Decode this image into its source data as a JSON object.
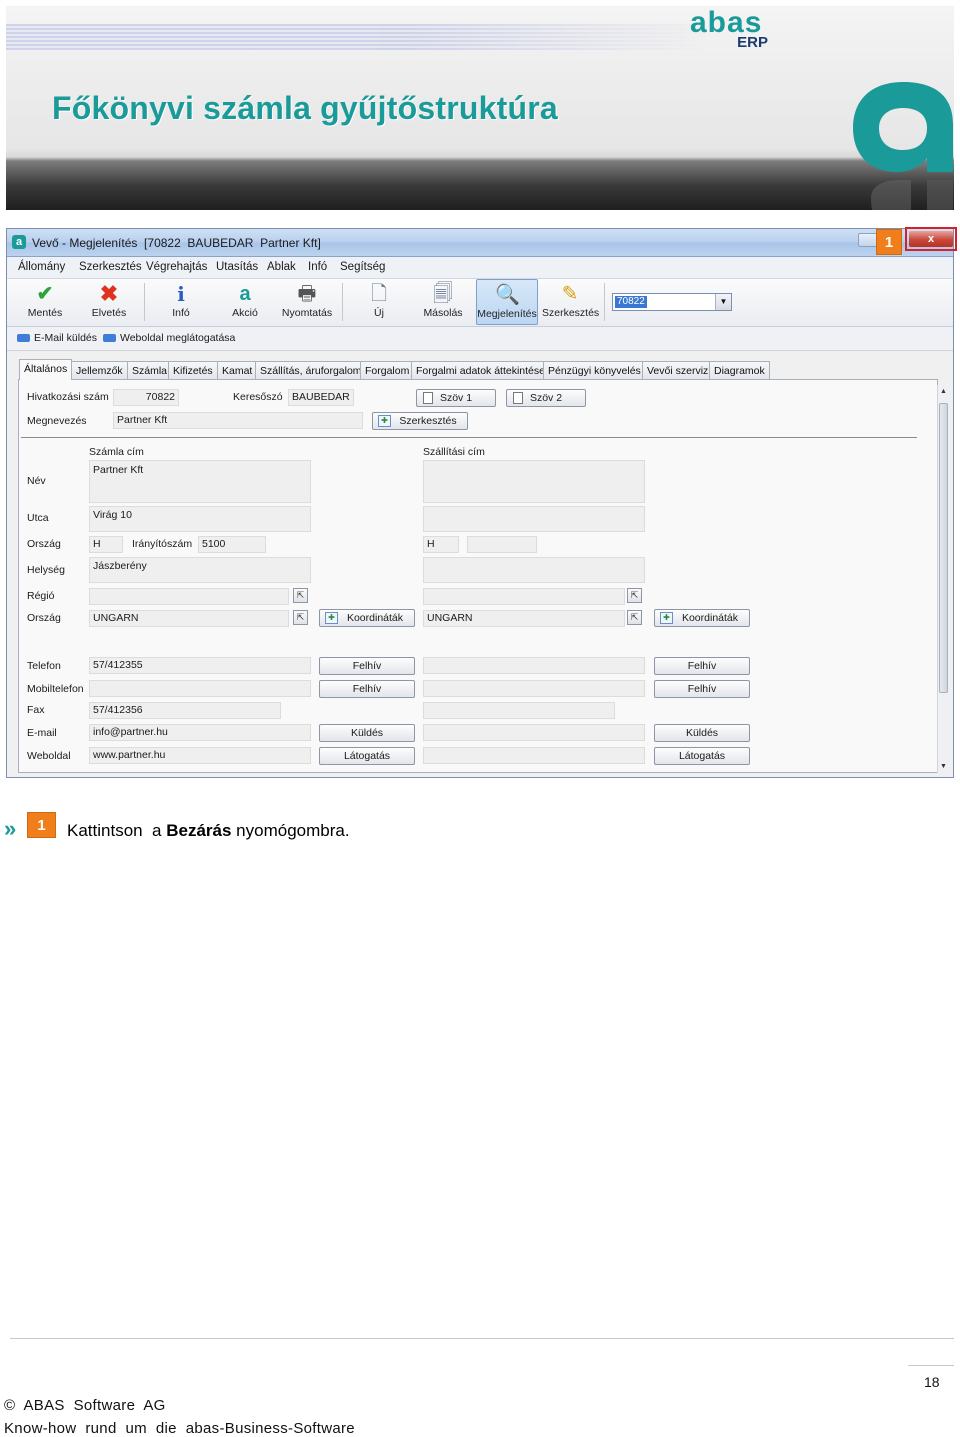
{
  "banner": {
    "title": "Főkönyvi számla gyűjtőstruktúra",
    "logo_word": "abas",
    "logo_sub": "ERP"
  },
  "window": {
    "title": "Vevő - Megjelenítés  [70822  BAUBEDAR  Partner Kft]",
    "callout": "1",
    "close": "x"
  },
  "menu": [
    "Állomány",
    "Szerkesztés",
    "Végrehajtás",
    "Utasítás",
    "Ablak",
    "Infó",
    "Segítség"
  ],
  "toolbar": {
    "buttons": [
      "Mentés",
      "Elvetés",
      "Infó",
      "Akció",
      "Nyomtatás",
      "Új",
      "Másolás",
      "Megjelenítés",
      "Szerkesztés"
    ],
    "combo_value": "70822"
  },
  "links": [
    "E-Mail küldés",
    "Weboldal meglátogatása"
  ],
  "tabs": [
    "Általános",
    "Jellemzők",
    "Számla",
    "Kifizetés",
    "Kamat",
    "Szállítás, áruforgalom",
    "Forgalom",
    "Forgalmi adatok áttekintése",
    "Pénzügyi könyvelés",
    "Vevői szerviz",
    "Diagramok"
  ],
  "form": {
    "ref_label": "Hivatkozási szám",
    "ref_value": "70822",
    "search_label": "Keresőszó",
    "search_value": "BAUBEDAR",
    "text1": "Szöv 1",
    "text2": "Szöv 2",
    "name_label": "Megnevezés",
    "name_value": "Partner Kft",
    "edit_btn": "Szerkesztés",
    "billing_header": "Számla cím",
    "shipping_header": "Szállítási cím",
    "labels": {
      "nev": "Név",
      "utca": "Utca",
      "orszag": "Ország",
      "helyseg": "Helység",
      "regio": "Régió",
      "orszag2": "Ország",
      "telefon": "Telefon",
      "mobil": "Mobiltelefon",
      "fax": "Fax",
      "email": "E-mail",
      "web": "Weboldal",
      "zip": "Irányítószám"
    },
    "billing": {
      "name": "Partner Kft",
      "street": "Virág 10",
      "country_code": "H",
      "zip": "5100",
      "city": "Jászberény",
      "region": "",
      "country": "UNGARN",
      "phone": "57/412355",
      "mobile": "",
      "fax": "57/412356",
      "email": "info@partner.hu",
      "web": "www.partner.hu"
    },
    "shipping": {
      "country_code": "H",
      "country": "UNGARN"
    },
    "buttons": {
      "coords": "Koordináták",
      "call": "Felhív",
      "send": "Küldés",
      "visit": "Látogatás"
    }
  },
  "instruction": {
    "badge": "1",
    "text_before": "Kattintson  a ",
    "text_bold": "Bezárás",
    "text_after": " nyomógombra."
  },
  "footer": {
    "page": "18",
    "copyright": "©  ABAS  Software  AG",
    "tagline": "Know-how  rund  um  die  abas-Business-Software"
  }
}
